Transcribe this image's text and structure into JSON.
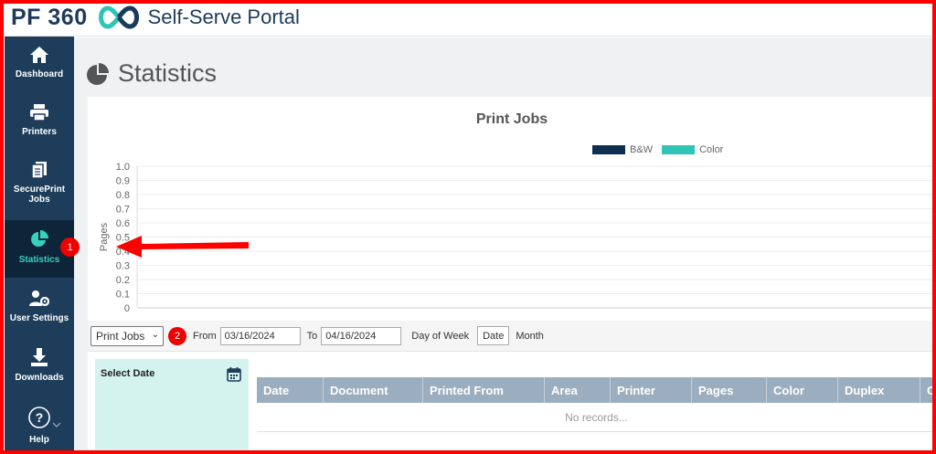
{
  "app": {
    "logo_text": "PF 360",
    "portal_title": "Self-Serve Portal"
  },
  "sidebar": {
    "items": [
      {
        "label": "Dashboard",
        "icon": "home-icon"
      },
      {
        "label": "Printers",
        "icon": "printer-icon"
      },
      {
        "label": "SecurePrint Jobs",
        "icon": "documents-icon"
      },
      {
        "label": "Statistics",
        "icon": "pie-chart-icon",
        "active": true
      },
      {
        "label": "User Settings",
        "icon": "user-gear-icon"
      },
      {
        "label": "Downloads",
        "icon": "download-icon"
      },
      {
        "label": "Help",
        "icon": "help-icon"
      }
    ]
  },
  "page": {
    "title": "Statistics"
  },
  "chart": {
    "title": "Print Jobs",
    "ylabel": "Pages",
    "legend": [
      {
        "name": "B&W",
        "color": "#0f2f52"
      },
      {
        "name": "Color",
        "color": "#2ec4b6"
      }
    ]
  },
  "chart_data": {
    "type": "bar",
    "title": "Print Jobs",
    "ylabel": "Pages",
    "xlabel": "",
    "ylim": [
      0,
      1.0
    ],
    "yticks": [
      "1.0",
      "0.9",
      "0.8",
      "0.7",
      "0.6",
      "0.5",
      "0.4",
      "0.3",
      "0.2",
      "0.1",
      "0"
    ],
    "categories": [],
    "series": [
      {
        "name": "B&W",
        "values": []
      },
      {
        "name": "Color",
        "values": []
      }
    ],
    "grid": true,
    "legend_position": "top"
  },
  "filters": {
    "report_type": "Print Jobs",
    "badge": "2",
    "from_label": "From",
    "from_value": "03/16/2024",
    "to_label": "To",
    "to_value": "04/16/2024",
    "day_of_week_label": "Day of Week",
    "date_button": "Date",
    "month_label": "Month"
  },
  "select_date": {
    "title": "Select Date"
  },
  "table": {
    "columns": [
      "Date",
      "Document",
      "Printed From",
      "Area",
      "Printer",
      "Pages",
      "Color",
      "Duplex",
      "C"
    ],
    "empty_text": "No records..."
  },
  "annotations": {
    "badge1": "1"
  },
  "colors": {
    "sidebar": "#1e3d5a",
    "accent": "#38d1c0",
    "table_header": "#9aaebf",
    "annotation": "#ff0000"
  }
}
